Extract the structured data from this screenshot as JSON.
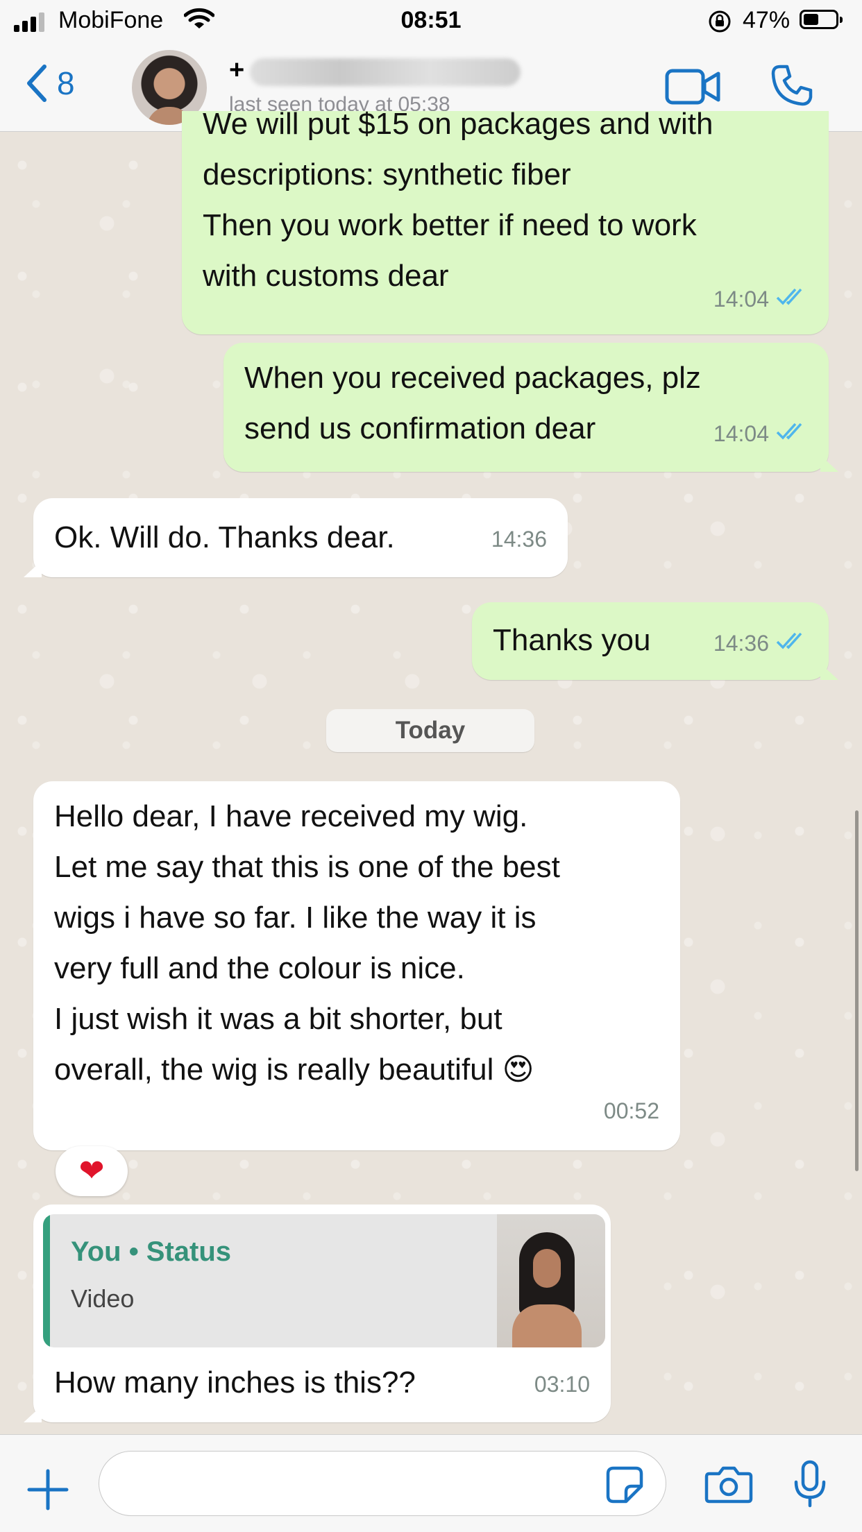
{
  "status_bar": {
    "carrier": "MobiFone",
    "time": "08:51",
    "battery_percent": "47%",
    "battery_level": 0.47
  },
  "header": {
    "back_count": "8",
    "contact_name": "+",
    "last_seen": "last seen today at 05:38",
    "accent_color": "#1a74c4"
  },
  "messages": [
    {
      "direction": "out",
      "text": "We will put $15 on packages and with\ndescriptions: synthetic fiber\nThen you work better if need to work\nwith customs dear",
      "time": "14:04",
      "status": "read"
    },
    {
      "direction": "out",
      "text": "When you received packages, plz\nsend us confirmation dear",
      "time": "14:04",
      "status": "read"
    },
    {
      "direction": "in",
      "text": "Ok. Will do. Thanks dear.",
      "time": "14:36"
    },
    {
      "direction": "out",
      "text": "Thanks you",
      "time": "14:36",
      "status": "read"
    },
    {
      "direction": "in",
      "text": "Hello dear, I have received my wig.\nLet me say that this is one of the best\nwigs i have so far. I like the way it is\nvery full and the colour is nice.\nI just wish it was a bit shorter, but\noverall, the wig is really beautiful 😍",
      "time": "00:52",
      "reaction": "❤"
    },
    {
      "direction": "in",
      "quote": {
        "author": "You • Status",
        "type": "Video"
      },
      "text": "How many inches is this??",
      "time": "03:10"
    }
  ],
  "day_separator": "Today",
  "colors": {
    "outgoing_bubble": "#dcf8c6",
    "incoming_bubble": "#ffffff",
    "read_ticks": "#4fb6ec",
    "quote_accent": "#35a07e"
  },
  "input_bar": {
    "message_value": ""
  }
}
